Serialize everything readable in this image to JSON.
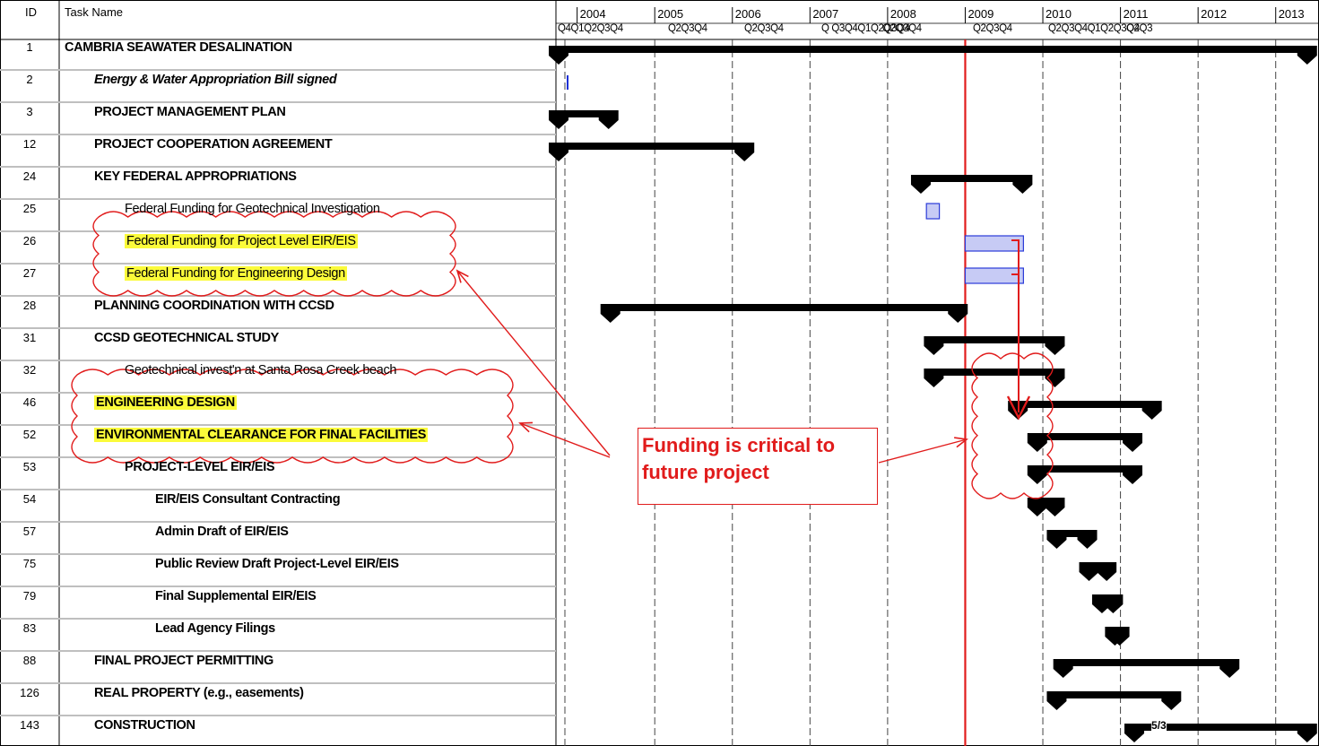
{
  "header": {
    "id_label": "ID",
    "name_label": "Task Name"
  },
  "timeline": {
    "years": [
      "2004",
      "2005",
      "2006",
      "2007",
      "2008",
      "2009",
      "2010",
      "2011",
      "2012",
      "2013"
    ],
    "quarter_strip": [
      "Q4Q1Q2Q3Q4",
      "Q2Q3Q4",
      "Q2Q3Q4",
      "Q  Q3Q4Q1Q2Q3Q4",
      "Q2Q3Q4",
      "Q2Q3Q4",
      "Q2Q3Q4Q1Q2Q3Q4",
      "Q2Q3"
    ]
  },
  "callout": {
    "line1": "Funding is critical to",
    "line2": "future project",
    "color": "#e11c1c"
  },
  "highlight_color": "#fbfb3a",
  "chart_data": {
    "type": "gantt",
    "x_range": [
      "2003-Q4",
      "2013-Q2"
    ],
    "today_line": "2009-Q1",
    "rows": [
      {
        "id": "1",
        "name": "CAMBRIA SEAWATER DESALINATION",
        "level": 0,
        "style": "bold",
        "bar": {
          "start": "2003-10",
          "end": "2013-06",
          "kind": "summary"
        }
      },
      {
        "id": "2",
        "name": "Energy & Water Appropriation Bill signed",
        "level": 1,
        "style": "bold-italic",
        "bar": {
          "start": "2003-10",
          "end": "2003-10",
          "kind": "milestone"
        }
      },
      {
        "id": "3",
        "name": "PROJECT MANAGEMENT PLAN",
        "level": 1,
        "style": "bold",
        "bar": {
          "start": "2003-10",
          "end": "2004-06",
          "kind": "summary"
        }
      },
      {
        "id": "12",
        "name": "PROJECT COOPERATION AGREEMENT",
        "level": 1,
        "style": "bold",
        "bar": {
          "start": "2003-10",
          "end": "2006-03",
          "kind": "summary"
        }
      },
      {
        "id": "24",
        "name": "KEY FEDERAL APPROPRIATIONS",
        "level": 1,
        "style": "bold",
        "bar": {
          "start": "2008-06",
          "end": "2009-10",
          "kind": "summary"
        }
      },
      {
        "id": "25",
        "name": "Federal Funding for Geotechnical Investigation",
        "level": 2,
        "style": "normal",
        "bar": {
          "start": "2008-07",
          "end": "2008-09",
          "kind": "task"
        }
      },
      {
        "id": "26",
        "name": "Federal Funding for Project Level EIR/EIS",
        "level": 2,
        "style": "normal",
        "highlight": true,
        "bar": {
          "start": "2009-01",
          "end": "2009-10",
          "kind": "task"
        }
      },
      {
        "id": "27",
        "name": "Federal Funding for Engineering Design",
        "level": 2,
        "style": "normal",
        "highlight": true,
        "bar": {
          "start": "2009-01",
          "end": "2009-10",
          "kind": "task"
        }
      },
      {
        "id": "28",
        "name": "PLANNING COORDINATION WITH CCSD",
        "level": 1,
        "style": "bold",
        "bar": {
          "start": "2004-06",
          "end": "2008-12",
          "kind": "summary"
        }
      },
      {
        "id": "31",
        "name": "CCSD GEOTECHNICAL STUDY",
        "level": 1,
        "style": "bold",
        "bar": {
          "start": "2008-08",
          "end": "2010-03",
          "kind": "summary"
        }
      },
      {
        "id": "32",
        "name": "Geotechnical invest'n at Santa Rosa Creek beach",
        "level": 2,
        "style": "normal",
        "bar": {
          "start": "2008-08",
          "end": "2010-03",
          "kind": "summary"
        }
      },
      {
        "id": "46",
        "name": "ENGINEERING DESIGN",
        "level": 1,
        "style": "bold",
        "highlight": true,
        "bar": {
          "start": "2009-09",
          "end": "2011-06",
          "kind": "summary"
        }
      },
      {
        "id": "52",
        "name": "ENVIRONMENTAL CLEARANCE FOR FINAL FACILITIES",
        "level": 1,
        "style": "bold",
        "highlight": true,
        "bar": {
          "start": "2009-12",
          "end": "2011-03",
          "kind": "summary"
        }
      },
      {
        "id": "53",
        "name": "PROJECT-LEVEL EIR/EIS",
        "level": 2,
        "style": "bold",
        "bar": {
          "start": "2009-12",
          "end": "2011-03",
          "kind": "summary"
        }
      },
      {
        "id": "54",
        "name": "EIR/EIS Consultant Contracting",
        "level": 3,
        "style": "bold",
        "bar": {
          "start": "2009-12",
          "end": "2010-03",
          "kind": "summary"
        }
      },
      {
        "id": "57",
        "name": "Admin Draft of EIR/EIS",
        "level": 3,
        "style": "bold",
        "bar": {
          "start": "2010-03",
          "end": "2010-08",
          "kind": "summary"
        }
      },
      {
        "id": "75",
        "name": "Public Review Draft Project-Level EIR/EIS",
        "level": 3,
        "style": "bold",
        "bar": {
          "start": "2010-08",
          "end": "2010-11",
          "kind": "summary"
        }
      },
      {
        "id": "79",
        "name": "Final Supplemental EIR/EIS",
        "level": 3,
        "style": "bold",
        "bar": {
          "start": "2010-10",
          "end": "2010-12",
          "kind": "summary"
        }
      },
      {
        "id": "83",
        "name": "Lead Agency Filings",
        "level": 3,
        "style": "bold",
        "bar": {
          "start": "2010-12",
          "end": "2011-01",
          "kind": "summary"
        }
      },
      {
        "id": "88",
        "name": "FINAL PROJECT PERMITTING",
        "level": 1,
        "style": "bold",
        "bar": {
          "start": "2010-04",
          "end": "2012-06",
          "kind": "summary"
        }
      },
      {
        "id": "126",
        "name": "REAL PROPERTY (e.g., easements)",
        "level": 1,
        "style": "bold",
        "bar": {
          "start": "2010-03",
          "end": "2011-09",
          "kind": "summary"
        }
      },
      {
        "id": "143",
        "name": "CONSTRUCTION",
        "level": 1,
        "style": "bold",
        "bar": {
          "start": "2011-03",
          "end": "2013-06",
          "kind": "summary",
          "label": "5/3"
        }
      }
    ]
  }
}
